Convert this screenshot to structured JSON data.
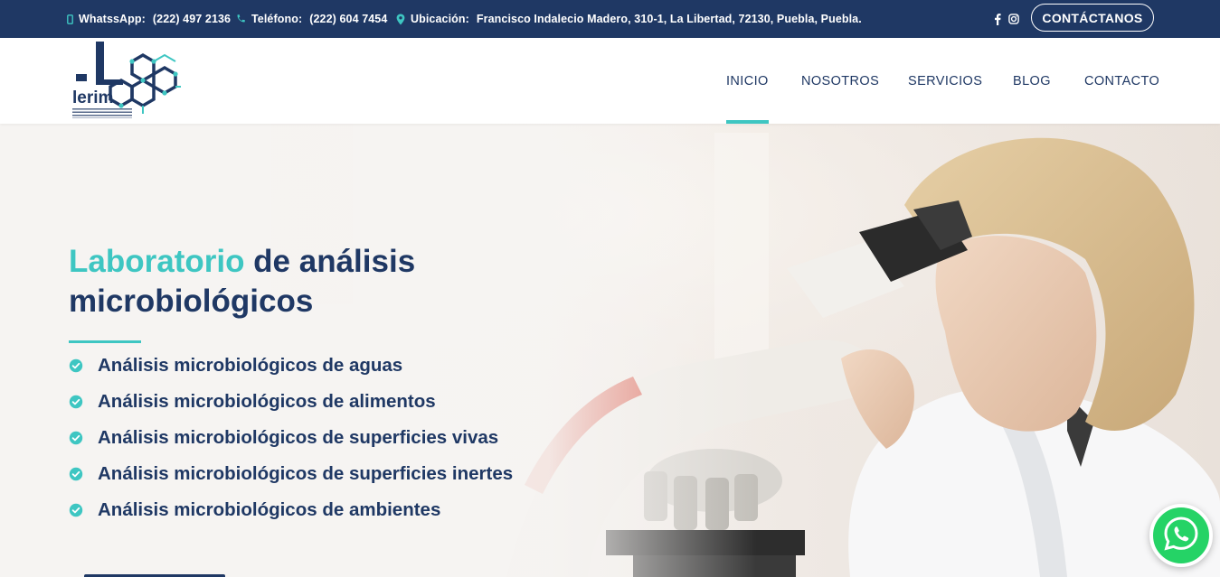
{
  "topbar": {
    "whatsapp_label": "WhatssApp:",
    "whatsapp_value": "(222) 497 2136",
    "phone_label": "Teléfono:",
    "phone_value": "(222) 604 7454",
    "location_label": "Ubicación:",
    "location_value": "Francisco Indalecio Madero, 310-1, La Libertad, 72130, Puebla, Puebla.",
    "contact_button": "CONTÁCTANOS",
    "social": [
      "facebook-icon",
      "instagram-icon"
    ]
  },
  "brand": {
    "logo_text": "lerim"
  },
  "nav": {
    "items": [
      {
        "label": "INICIO",
        "active": true
      },
      {
        "label": "NOSOTROS",
        "active": false
      },
      {
        "label": "SERVICIOS",
        "active": false
      },
      {
        "label": "BLOG",
        "active": false
      },
      {
        "label": "CONTACTO",
        "active": false
      }
    ]
  },
  "hero": {
    "title_accent": "Laboratorio",
    "title_rest": " de análisis microbiológicos",
    "services": [
      "Análisis microbiológicos de aguas",
      "Análisis microbiológicos de alimentos",
      "Análisis microbiológicos de superficies vivas",
      "Análisis microbiológicos de superficies inertes",
      "Análisis microbiológicos de ambientes"
    ]
  },
  "colors": {
    "navy": "#1f3864",
    "teal": "#3ec6c2",
    "whatsapp": "#25d366"
  },
  "floating": {
    "whatsapp_icon": "whatsapp-icon"
  }
}
